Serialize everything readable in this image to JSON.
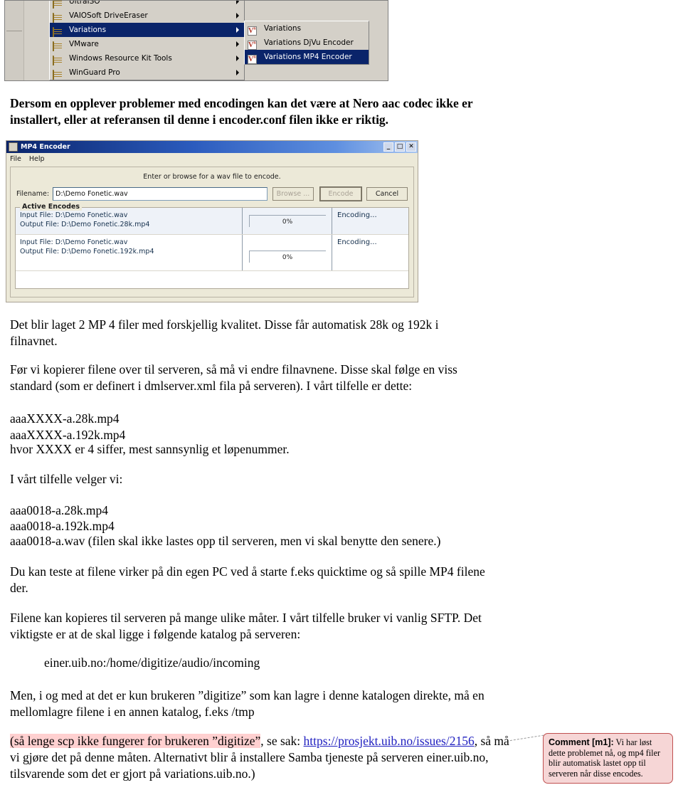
{
  "menu_shot": {
    "items": [
      {
        "label": "UltraISO",
        "selected": false
      },
      {
        "label": "VAIOSoft DriveEraser",
        "selected": false
      },
      {
        "label": "Variations",
        "selected": true
      },
      {
        "label": "VMware",
        "selected": false
      },
      {
        "label": "Windows Resource Kit Tools",
        "selected": false
      },
      {
        "label": "WinGuard Pro",
        "selected": false
      }
    ],
    "submenu": [
      {
        "label": "Variations",
        "selected": false
      },
      {
        "label": "Variations DjVu Encoder",
        "selected": false
      },
      {
        "label": "Variations MP4 Encoder",
        "selected": true
      }
    ],
    "icon_glyph": "V",
    "icon_sup": "n",
    "highlight_color": "#0a246a"
  },
  "para_warning": "Dersom en opplever problemer med encodingen kan det være at Nero aac codec ikke er installert, eller at referansen til denne i encoder.conf filen ikke er riktig.",
  "encoder_shot": {
    "title": "MP4 Encoder",
    "window_buttons": {
      "minimize": "_",
      "maximize": "□",
      "close": "✕"
    },
    "menus": [
      "File",
      "Help"
    ],
    "hint": "Enter or browse for a wav file to encode.",
    "filename_label": "Filename:",
    "filename_value": "D:\\Demo Fonetic.wav",
    "buttons": {
      "browse": "Browse ...",
      "encode": "Encode",
      "cancel": "Cancel"
    },
    "group_legend": "Active Encodes",
    "encodes": [
      {
        "input": "Input File: D:\\Demo Fonetic.wav",
        "output": "Output File: D:\\Demo Fonetic.28k.mp4",
        "progress": "0%",
        "status": "Encoding..."
      },
      {
        "input": "Input File: D:\\Demo Fonetic.wav",
        "output": "Output File: D:\\Demo Fonetic.192k.mp4",
        "progress": "0%",
        "status": "Encoding..."
      }
    ]
  },
  "para_2files": "Det blir laget 2 MP 4 filer med forskjellig kvalitet. Disse får automatisk 28k og 192k i filnavnet.",
  "para_rename": "Før vi kopierer filene over til serveren, så må vi endre filnavnene. Disse skal følge en viss standard (som er definert i dmlserver.xml fila på serveren). I vårt tilfelle er dette:",
  "filename_pattern_1": "aaaXXXX-a.28k.mp4",
  "filename_pattern_2": "aaaXXXX-a.192k.mp4",
  "para_xxxx": "hvor XXXX er 4 siffer, mest sannsynlig et løpenummer.",
  "para_velger": "I vårt tilfelle velger vi:",
  "example_1": "aaa0018-a.28k.mp4",
  "example_2": "aaa0018-a.192k.mp4",
  "example_3": "aaa0018-a.wav (filen skal ikke lastes opp til serveren, men vi skal benytte den senere.)",
  "para_test": "Du kan teste at filene virker på din egen PC ved å starte f.eks quicktime og så spille MP4 filene der.",
  "para_sftp": "Filene kan kopieres til serveren på mange ulike måter. I vårt tilfelle bruker vi vanlig SFTP. Det viktigste er at de skal ligge i følgende katalog på serveren:",
  "server_path": "einer.uib.no:/home/digitize/audio/incoming",
  "para_digitize": "Men, i og med at det er kun brukeren ”digitize” som kan lagre i denne katalogen direkte, må en mellomlagre filene i en annen katalog, f.eks /tmp",
  "para_scp": {
    "highlighted": "(så lenge scp ikke fungerer for brukeren ”digitize”",
    "mid": ", se sak: ",
    "link": "https://prosjekt.uib.no/issues/2156",
    "rest_line1": ",",
    "line2": "så må vi gjøre det på denne måten. Alternativt blir å installere Samba tjeneste på serveren",
    "line3": "einer.uib.no, tilsvarende som det er gjort på variations.uib.no.)"
  },
  "comment": {
    "label": "Comment [m1]:",
    "text": " Vi har løst dette problemet nå, og mp4 filer blir automatisk lastet opp til serveren når disse encodes.",
    "bg_color": "#f6d6d6",
    "border_color": "#c05050"
  }
}
